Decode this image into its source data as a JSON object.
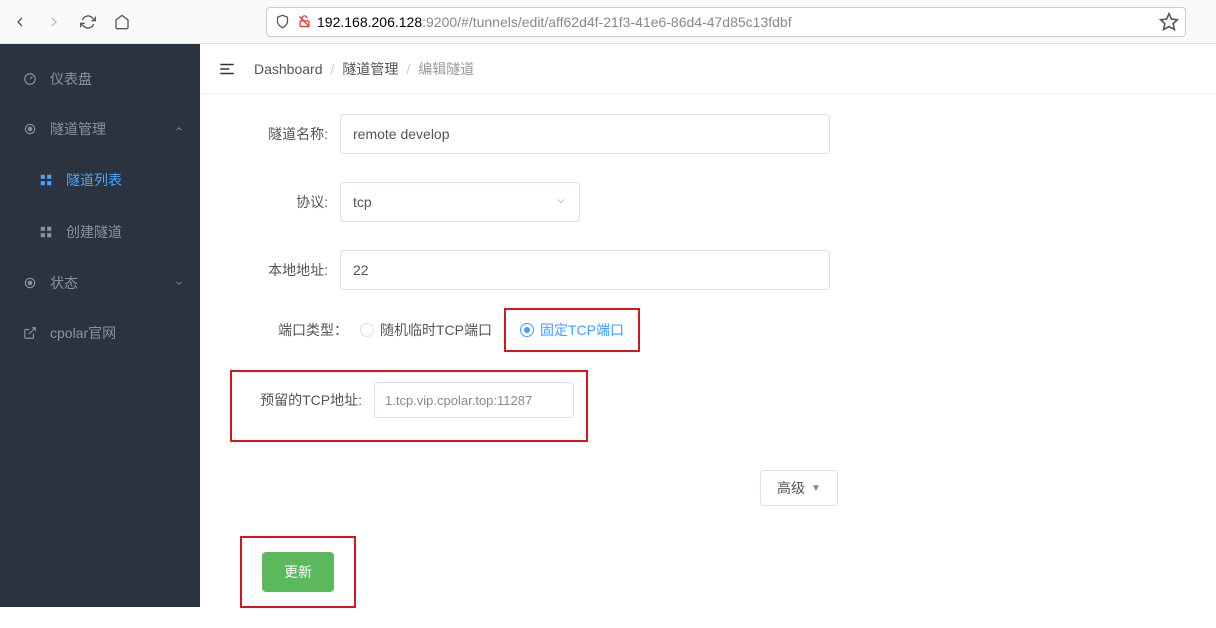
{
  "browser": {
    "url_host": "192.168.206.128",
    "url_path": ":9200/#/tunnels/edit/aff62d4f-21f3-41e6-86d4-47d85c13fdbf"
  },
  "sidebar": {
    "items": [
      {
        "label": "仪表盘",
        "icon": "dashboard"
      },
      {
        "label": "隧道管理",
        "icon": "target",
        "expanded": true
      },
      {
        "label": "隧道列表",
        "sub": true,
        "active": true
      },
      {
        "label": "创建隧道",
        "sub": true
      },
      {
        "label": "状态",
        "icon": "target",
        "expanded": false
      },
      {
        "label": "cpolar官网",
        "icon": "external"
      }
    ]
  },
  "topbar": {
    "breadcrumbs": [
      "Dashboard",
      "隧道管理",
      "编辑隧道"
    ]
  },
  "form": {
    "tunnel_name": {
      "label": "隧道名称:",
      "value": "remote develop"
    },
    "protocol": {
      "label": "协议:",
      "value": "tcp"
    },
    "local_addr": {
      "label": "本地地址:",
      "value": "22"
    },
    "port_type": {
      "label": "端口类型：",
      "options": [
        {
          "label": "随机临时TCP端口",
          "selected": false
        },
        {
          "label": "固定TCP端口",
          "selected": true
        }
      ]
    },
    "reserved_tcp": {
      "label": "预留的TCP地址:",
      "value": "1.tcp.vip.cpolar.top:11287"
    },
    "advanced": {
      "label": "高级"
    },
    "submit": {
      "label": "更新"
    }
  }
}
